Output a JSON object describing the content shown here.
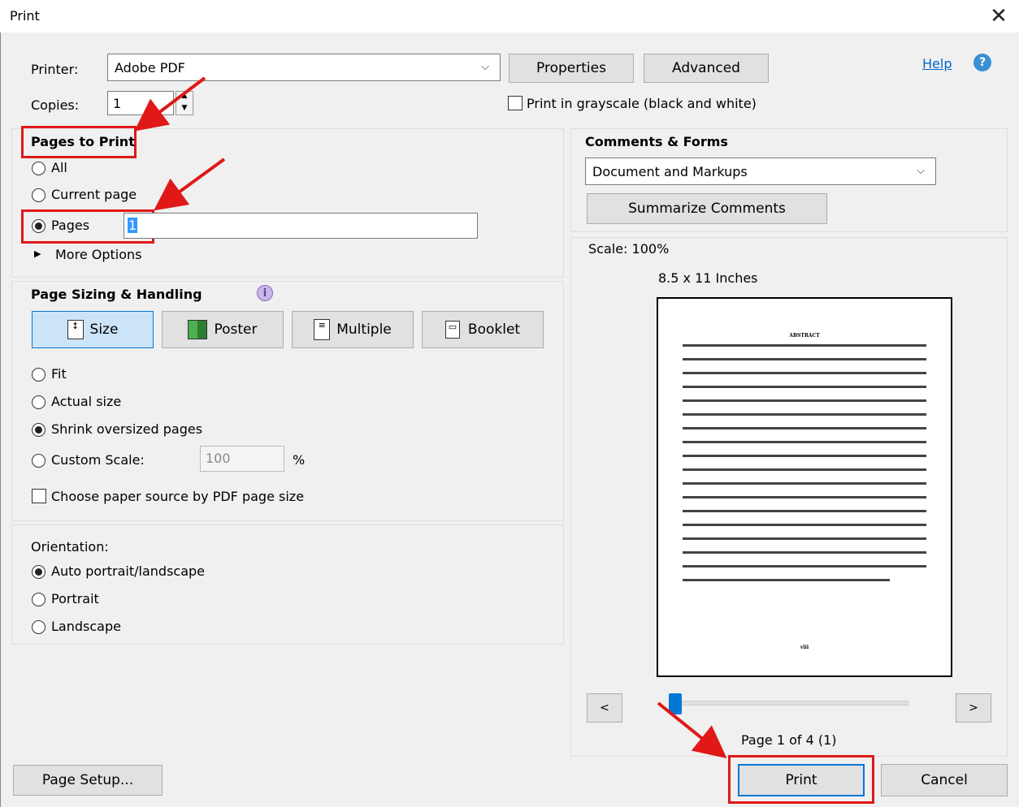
{
  "window": {
    "title": "Print",
    "close_glyph": "✕"
  },
  "printer": {
    "label": "Printer:",
    "value": "Adobe PDF",
    "properties": "Properties",
    "advanced": "Advanced",
    "help": "Help"
  },
  "copies": {
    "label": "Copies:",
    "value": "1"
  },
  "grayscale": {
    "label": "Print in grayscale (black and white)",
    "checked": false
  },
  "pages_to_print": {
    "heading": "Pages to Print",
    "options": [
      "All",
      "Current page",
      "Pages"
    ],
    "selected": "Pages",
    "pages_value": "1",
    "more_options": "More Options"
  },
  "sizing": {
    "heading": "Page Sizing & Handling",
    "tabs": [
      "Size",
      "Poster",
      "Multiple",
      "Booklet"
    ],
    "active_tab": "Size",
    "options": [
      "Fit",
      "Actual size",
      "Shrink oversized pages",
      "Custom Scale:"
    ],
    "selected": "Shrink oversized pages",
    "custom_scale_value": "100",
    "percent": "%",
    "paper_source": "Choose paper source by PDF page size"
  },
  "orientation": {
    "label": "Orientation:",
    "options": [
      "Auto portrait/landscape",
      "Portrait",
      "Landscape"
    ],
    "selected": "Auto portrait/landscape"
  },
  "comments": {
    "heading": "Comments & Forms",
    "value": "Document and Markups",
    "summarize": "Summarize Comments"
  },
  "preview": {
    "scale": "Scale: 100%",
    "paper_size": "8.5 x 11 Inches",
    "doc_heading": "ABSTRACT",
    "page_number": "viii",
    "prev": "<",
    "next": ">",
    "page_status": "Page 1 of 4 (1)"
  },
  "buttons": {
    "page_setup": "Page Setup...",
    "print": "Print",
    "cancel": "Cancel"
  },
  "colors": {
    "annotation_red": "#e01818",
    "accent_blue": "#0078d7"
  }
}
